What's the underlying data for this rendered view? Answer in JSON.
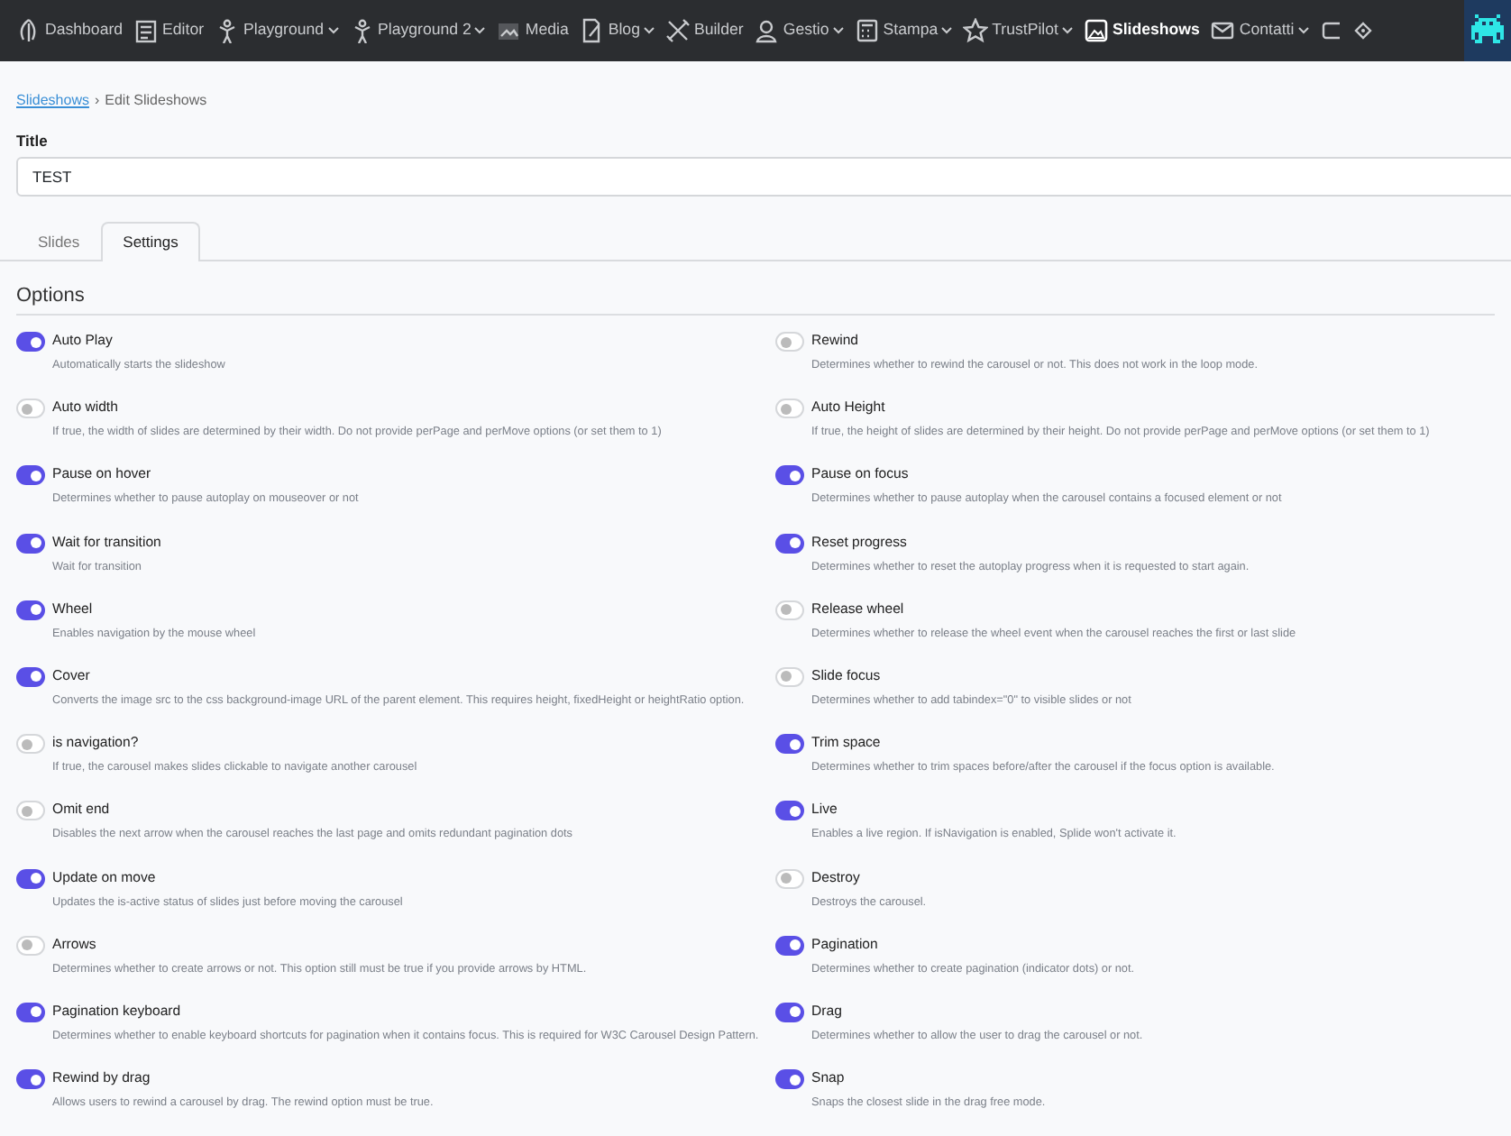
{
  "navbar": {
    "items": [
      {
        "label": "Dashboard",
        "dropdown": false,
        "selected": false
      },
      {
        "label": "Editor",
        "dropdown": false,
        "selected": false
      },
      {
        "label": "Playground",
        "dropdown": true,
        "selected": false
      },
      {
        "label": "Playground 2",
        "dropdown": true,
        "selected": false
      },
      {
        "label": "Media",
        "dropdown": false,
        "selected": false
      },
      {
        "label": "Blog",
        "dropdown": true,
        "selected": false
      },
      {
        "label": "Builder",
        "dropdown": false,
        "selected": false
      },
      {
        "label": "Gestio",
        "dropdown": true,
        "selected": false
      },
      {
        "label": "Stampa",
        "dropdown": true,
        "selected": false
      },
      {
        "label": "TrustPilot",
        "dropdown": true,
        "selected": false
      },
      {
        "label": "Slideshows",
        "dropdown": false,
        "selected": true
      },
      {
        "label": "Contatti",
        "dropdown": true,
        "selected": false
      }
    ]
  },
  "breadcrumb_separator": "›",
  "breadcrumb": [
    {
      "label": "Slideshows",
      "kind": "link"
    },
    {
      "label": "Edit Slideshows",
      "kind": "current"
    }
  ],
  "title_field": {
    "label": "Title",
    "value": "TEST"
  },
  "tabs": [
    {
      "label": "Slides",
      "selected": false
    },
    {
      "label": "Settings",
      "selected": true
    }
  ],
  "options_heading": "Options",
  "options": [
    {
      "label": "Auto Play",
      "description": "Automatically starts the slideshow",
      "on": true
    },
    {
      "label": "Rewind",
      "description": "Determines whether to rewind the carousel or not. This does not work in the loop mode.",
      "on": false
    },
    {
      "label": "Auto width",
      "description": "If true, the width of slides are determined by their width. Do not provide perPage and perMove options (or set them to 1)",
      "on": false
    },
    {
      "label": "Auto Height",
      "description": "If true, the height of slides are determined by their height. Do not provide perPage and perMove options (or set them to 1)",
      "on": false
    },
    {
      "label": "Pause on hover",
      "description": "Determines whether to pause autoplay on mouseover or not",
      "on": true
    },
    {
      "label": "Pause on focus",
      "description": "Determines whether to pause autoplay when the carousel contains a focused element or not",
      "on": true
    },
    {
      "label": "Wait for transition",
      "description": "Wait for transition",
      "on": true
    },
    {
      "label": "Reset progress",
      "description": "Determines whether to reset the autoplay progress when it is requested to start again.",
      "on": true
    },
    {
      "label": "Wheel",
      "description": "Enables navigation by the mouse wheel",
      "on": true
    },
    {
      "label": "Release wheel",
      "description": "Determines whether to release the wheel event when the carousel reaches the first or last slide",
      "on": false
    },
    {
      "label": "Cover",
      "description": "Converts the image src to the css background-image URL of the parent element. This requires height, fixedHeight or heightRatio option.",
      "on": true
    },
    {
      "label": "Slide focus",
      "description": "Determines whether to add tabindex=\"0\" to visible slides or not",
      "on": false
    },
    {
      "label": "is navigation?",
      "description": "If true, the carousel makes slides clickable to navigate another carousel",
      "on": false
    },
    {
      "label": "Trim space",
      "description": "Determines whether to trim spaces before/after the carousel if the focus option is available.",
      "on": true
    },
    {
      "label": "Omit end",
      "description": "Disables the next arrow when the carousel reaches the last page and omits redundant pagination dots",
      "on": false
    },
    {
      "label": "Live",
      "description": "Enables a live region. If isNavigation is enabled, Splide won't activate it.",
      "on": true
    },
    {
      "label": "Update on move",
      "description": "Updates the is-active status of slides just before moving the carousel",
      "on": true
    },
    {
      "label": "Destroy",
      "description": "Destroys the carousel.",
      "on": false
    },
    {
      "label": "Arrows",
      "description": "Determines whether to create arrows or not. This option still must be true if you provide arrows by HTML.",
      "on": false
    },
    {
      "label": "Pagination",
      "description": "Determines whether to create pagination (indicator dots) or not.",
      "on": true
    },
    {
      "label": "Pagination keyboard",
      "description": "Determines whether to enable keyboard shortcuts for pagination when it contains focus. This is required for W3C Carousel Design Pattern.",
      "on": true
    },
    {
      "label": "Drag",
      "description": "Determines whether to allow the user to drag the carousel or not.",
      "on": true
    },
    {
      "label": "Rewind by drag",
      "description": "Allows users to rewind a carousel by drag. The rewind option must be true.",
      "on": true
    },
    {
      "label": "Snap",
      "description": "Snaps the closest slide in the drag free mode.",
      "on": true
    }
  ]
}
